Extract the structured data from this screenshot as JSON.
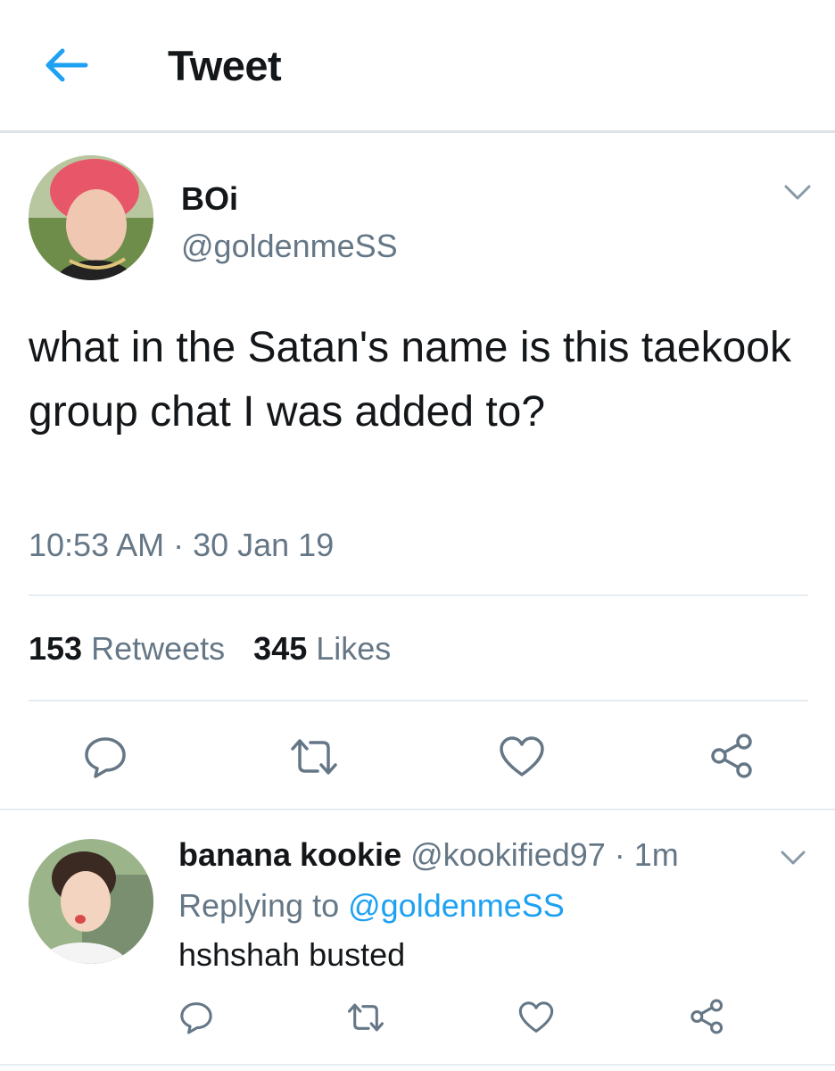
{
  "header": {
    "title": "Tweet",
    "back_icon": "arrow-left-icon",
    "accent": "#1da1f2"
  },
  "tweet": {
    "author_name": "BOi",
    "author_handle": "@goldenmeSS",
    "text": "what in the Satan's name is this taekook group chat I was added to?",
    "timestamp": "10:53 AM · 30 Jan 19",
    "retweets_count": "153",
    "retweets_label": "Retweets",
    "likes_count": "345",
    "likes_label": "Likes",
    "actions": [
      "reply-icon",
      "retweet-icon",
      "like-icon",
      "share-icon"
    ]
  },
  "reply": {
    "author_name": "banana kookie",
    "author_handle": "@kookified97",
    "time_sep": " · ",
    "time": "1m",
    "replying_prefix": "Replying to ",
    "replying_to": "@goldenmeSS",
    "text": "hshshah busted",
    "actions": [
      "reply-icon",
      "retweet-icon",
      "like-icon",
      "share-icon"
    ]
  },
  "colors": {
    "text": "#14171a",
    "muted": "#657786",
    "link": "#1da1f2",
    "divider": "#e6ecf0"
  }
}
